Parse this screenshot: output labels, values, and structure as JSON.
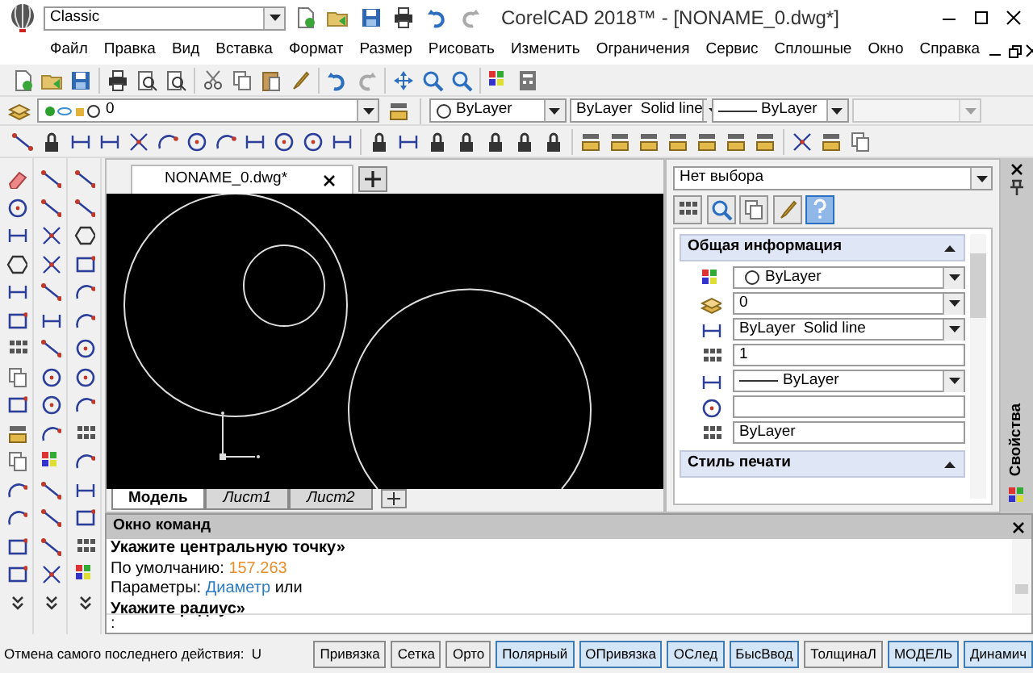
{
  "title_bar": {
    "workspace": "Classic",
    "title": "CorelCAD 2018™ - [NONAME_0.dwg*]"
  },
  "menu": [
    "Файл",
    "Правка",
    "Вид",
    "Вставка",
    "Формат",
    "Размер",
    "Рисовать",
    "Изменить",
    "Ограничения",
    "Сервис",
    "Сплошные",
    "Окно",
    "Справка"
  ],
  "layer_combo": {
    "value": "0"
  },
  "property_combos": [
    {
      "kind": "color",
      "value": "ByLayer",
      "disabled": false
    },
    {
      "kind": "linetype",
      "value": "ByLayer",
      "detail": "Solid line",
      "disabled": false
    },
    {
      "kind": "lineweight",
      "value": "ByLayer",
      "disabled": false
    },
    {
      "kind": "empty",
      "disabled": true
    }
  ],
  "document_tabs": [
    {
      "label": "NONAME_0.dwg*",
      "selected": true
    }
  ],
  "layout_tabs": [
    {
      "label": "Модель",
      "selected": true
    },
    {
      "label": "Лист1",
      "selected": false
    },
    {
      "label": "Лист2",
      "selected": false
    }
  ],
  "properties": {
    "selection": "Нет выбора",
    "side_tab": "Свойства",
    "sections": [
      {
        "title": "Общая информация",
        "expanded": true,
        "rows": [
          {
            "kind": "color",
            "value": "ByLayer"
          },
          {
            "kind": "combo",
            "value": "0"
          },
          {
            "kind": "combo",
            "value": "ByLayer",
            "detail": "Solid line"
          },
          {
            "kind": "field",
            "value": "1"
          },
          {
            "kind": "lineweight",
            "value": "ByLayer"
          },
          {
            "kind": "field"
          },
          {
            "kind": "field",
            "value": "ByLayer"
          }
        ]
      },
      {
        "title": "Стиль печати",
        "expanded": true
      }
    ]
  },
  "command_window": {
    "title": "Окно команд",
    "lines": [
      [
        {
          "kind": "prompt",
          "text": "Укажите центральную точку»"
        }
      ],
      [
        {
          "kind": "plain",
          "text": "По умолчанию:"
        },
        {
          "kind": "value",
          "text": "157.263"
        }
      ],
      [
        {
          "kind": "plain",
          "text": "Параметры:"
        },
        {
          "kind": "option",
          "text": "Диаметр"
        },
        {
          "kind": "plain",
          "text": "или"
        }
      ],
      [
        {
          "kind": "prompt",
          "text": "Укажите радиус»"
        }
      ]
    ],
    "input_prompt": ":"
  },
  "status_bar": {
    "message": "Отмена самого последнего действия:  U",
    "buttons": [
      {
        "label": "Привязка",
        "selected": false
      },
      {
        "label": "Сетка",
        "selected": false
      },
      {
        "label": "Орто",
        "selected": false
      },
      {
        "label": "Полярный",
        "selected": true
      },
      {
        "label": "ОПривязка",
        "selected": true
      },
      {
        "label": "ОСлед",
        "selected": true
      },
      {
        "label": "БысВвод",
        "selected": true
      },
      {
        "label": "ТолщинаЛ",
        "selected": false
      },
      {
        "label": "МОДЕЛЬ",
        "selected": true
      },
      {
        "label": "Динамич",
        "selected": true
      }
    ]
  }
}
